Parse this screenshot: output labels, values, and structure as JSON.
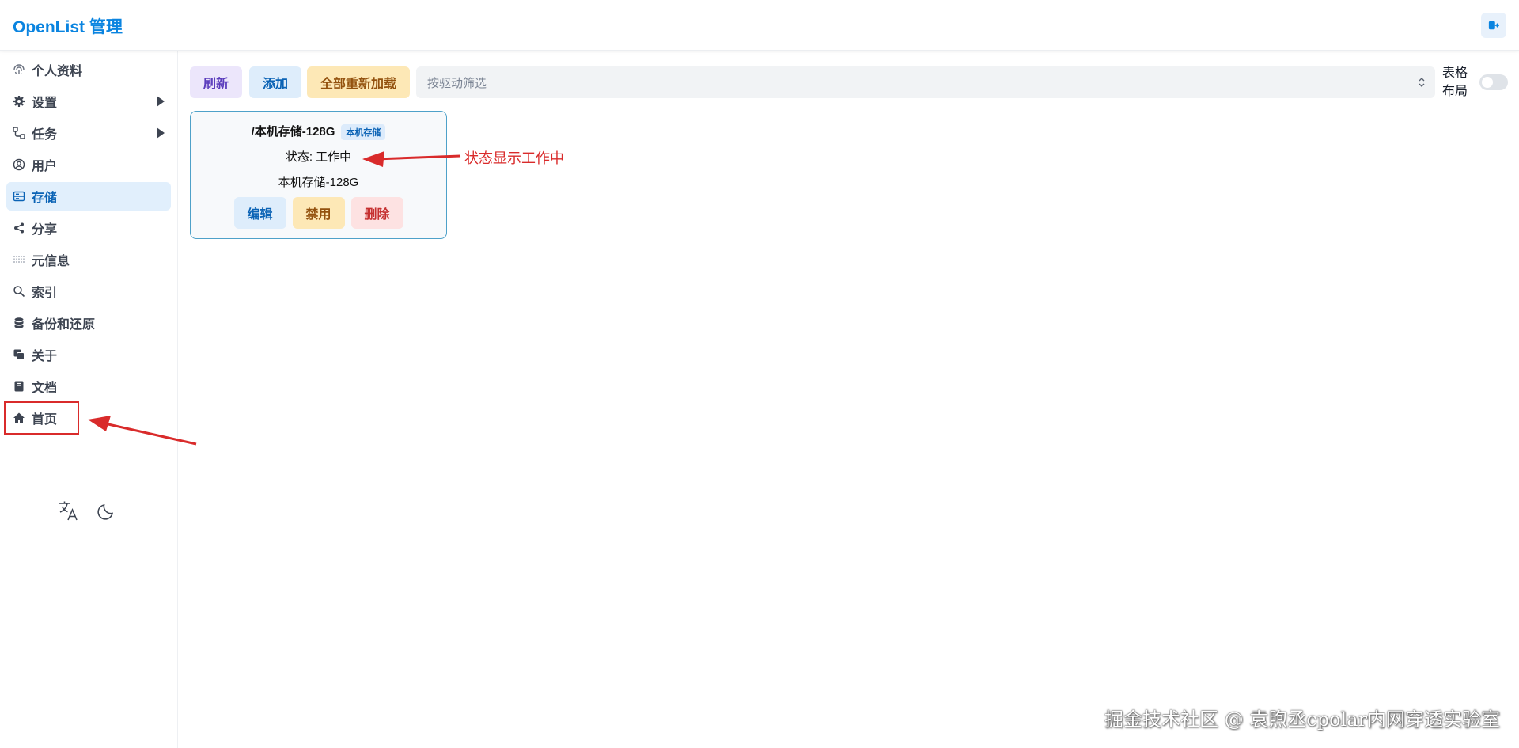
{
  "header": {
    "title": "OpenList 管理"
  },
  "sidebar": {
    "items": [
      {
        "label": "个人资料",
        "icon": "fingerprint-icon",
        "active": false
      },
      {
        "label": "设置",
        "icon": "gear-icon",
        "active": false,
        "expandable": true
      },
      {
        "label": "任务",
        "icon": "workflow-icon",
        "active": false,
        "expandable": true
      },
      {
        "label": "用户",
        "icon": "user-circle-icon",
        "active": false
      },
      {
        "label": "存储",
        "icon": "storage-icon",
        "active": true
      },
      {
        "label": "分享",
        "icon": "share-icon",
        "active": false
      },
      {
        "label": "元信息",
        "icon": "meta-icon",
        "active": false
      },
      {
        "label": "索引",
        "icon": "search-icon",
        "active": false
      },
      {
        "label": "备份和还原",
        "icon": "database-icon",
        "active": false
      },
      {
        "label": "关于",
        "icon": "copy-icon",
        "active": false
      },
      {
        "label": "文档",
        "icon": "book-icon",
        "active": false
      },
      {
        "label": "首页",
        "icon": "home-icon",
        "active": false
      }
    ],
    "tools": [
      "translate-icon",
      "moon-icon"
    ]
  },
  "toolbar": {
    "refresh_label": "刷新",
    "add_label": "添加",
    "reload_all_label": "全部重新加载",
    "filter_placeholder": "按驱动筛选",
    "layout_label_line1": "表格",
    "layout_label_line2": "布局",
    "table_layout_enabled": false
  },
  "storage": {
    "mount_path": "/本机存储-128G",
    "driver_tag": "本机存储",
    "status_text": "状态: 工作中",
    "remark": "本机存储-128G",
    "edit_label": "编辑",
    "disable_label": "禁用",
    "delete_label": "删除"
  },
  "annotations": {
    "status_note": "状态显示工作中",
    "color": "#d92b2b"
  },
  "watermark": "掘金技术社区 @ 袁煦丞cpolar内网穿透实验室",
  "colors": {
    "brand": "#0a84e0",
    "active_bg": "#e1effc",
    "annotation_red": "#d92b2b"
  }
}
